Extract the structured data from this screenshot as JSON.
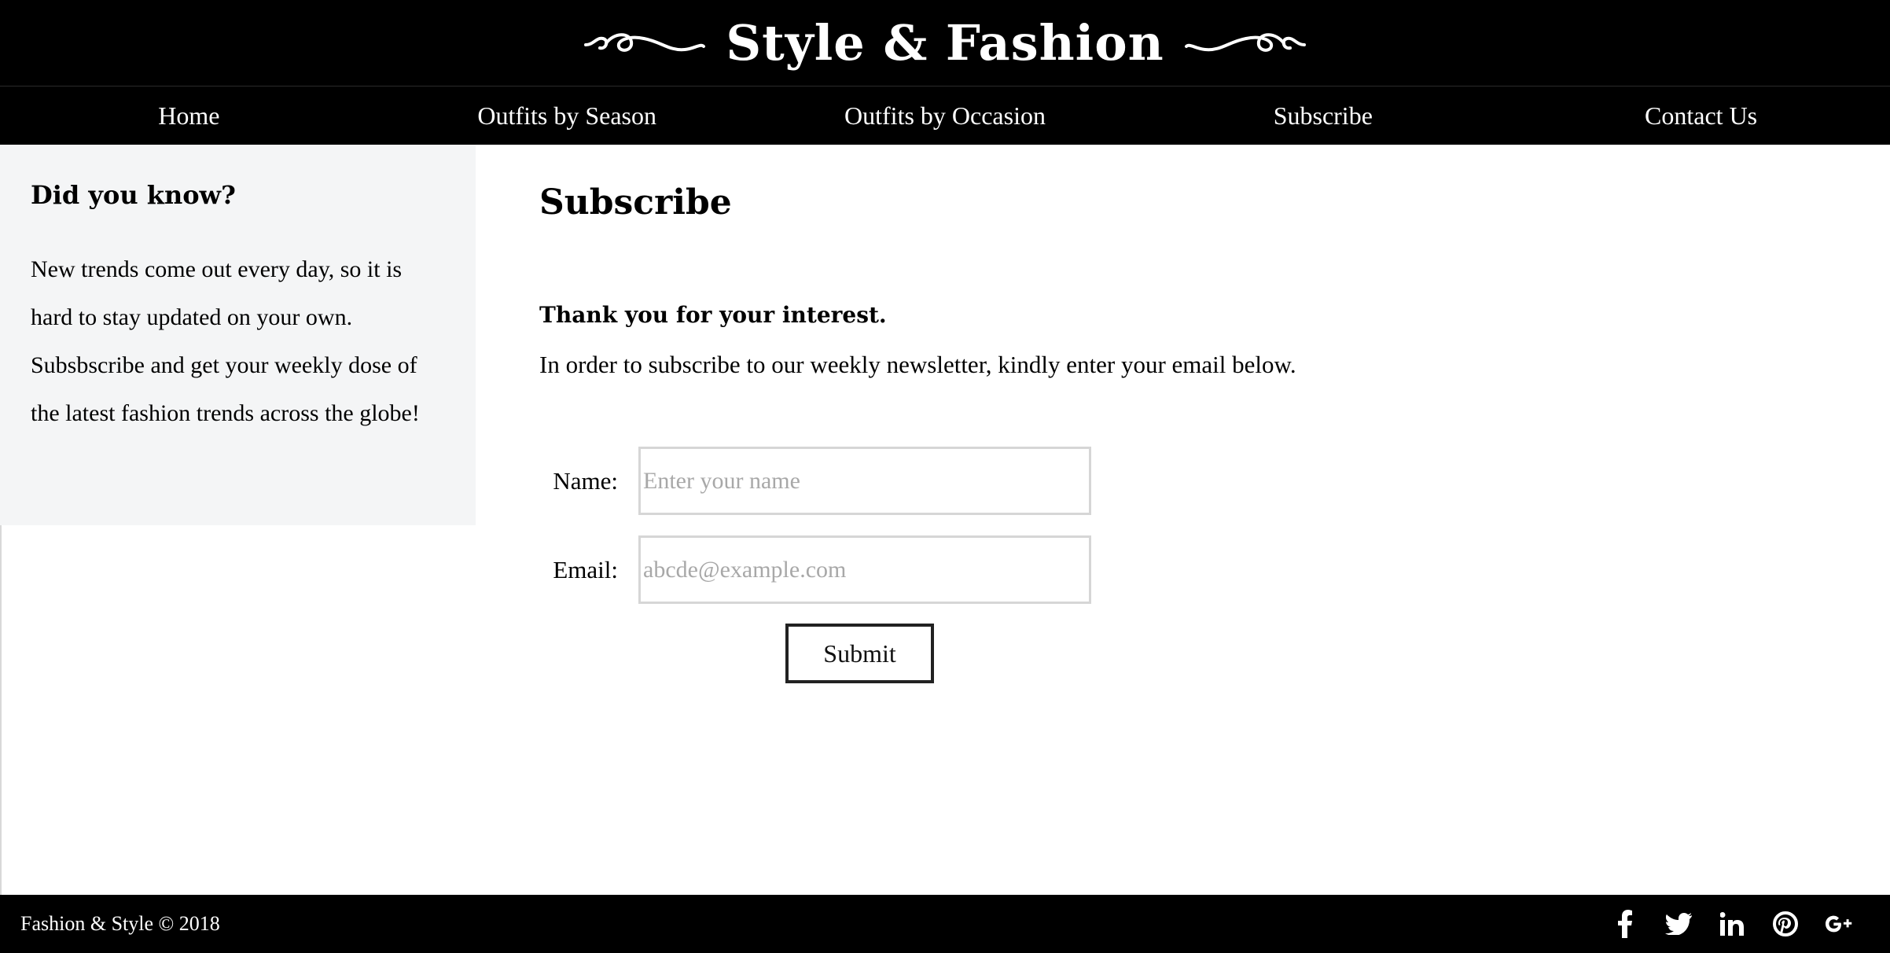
{
  "header": {
    "title": "Style & Fashion",
    "left_ornament_icon": "swirl-ornament-icon",
    "right_ornament_icon": "swirl-ornament-icon"
  },
  "nav": {
    "items": [
      {
        "label": "Home"
      },
      {
        "label": "Outfits by Season"
      },
      {
        "label": "Outfits by Occasion"
      },
      {
        "label": "Subscribe"
      },
      {
        "label": "Contact Us"
      }
    ]
  },
  "sidebar": {
    "heading": "Did you know?",
    "body": "New trends come out every day, so it is hard to stay updated on your own. Subsbscribe and get your weekly dose of the latest fashion trends across the globe!"
  },
  "main": {
    "title": "Subscribe",
    "lead": "Thank you for your interest.",
    "instructions": "In order to subscribe to our weekly newsletter, kindly enter your email below.",
    "form": {
      "name_label": "Name:",
      "name_placeholder": "Enter your name",
      "email_label": "Email:",
      "email_placeholder": "abcde@example.com",
      "submit_label": "Submit"
    }
  },
  "footer": {
    "copyright": "Fashion & Style © 2018",
    "socials": [
      {
        "icon": "facebook-icon"
      },
      {
        "icon": "twitter-icon"
      },
      {
        "icon": "linkedin-icon"
      },
      {
        "icon": "pinterest-icon"
      },
      {
        "icon": "google-plus-icon"
      }
    ]
  },
  "colors": {
    "header_bg": "#000000",
    "sidebar_bg": "#f4f5f6",
    "text": "#000000",
    "input_border": "#d6d6d6",
    "placeholder": "#a8a8a8"
  }
}
